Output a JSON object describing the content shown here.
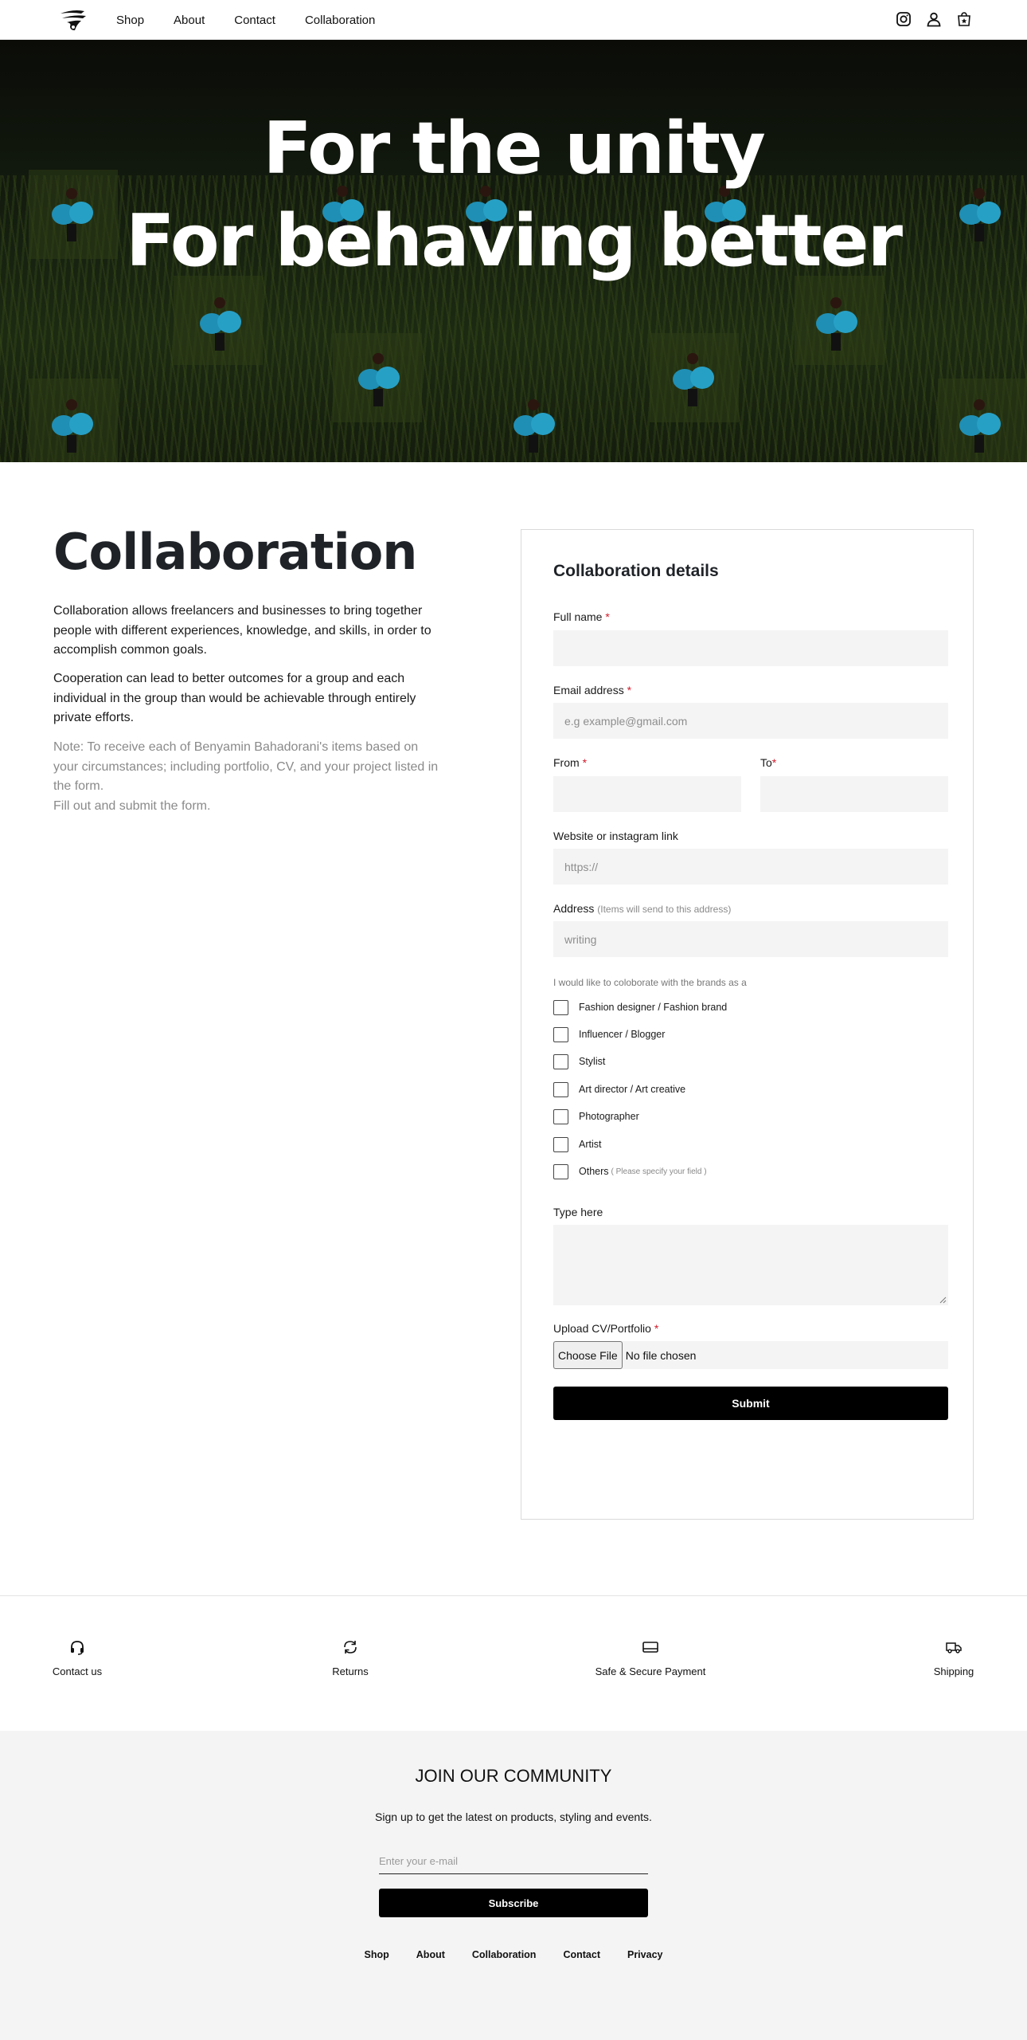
{
  "header": {
    "nav": [
      "Shop",
      "About",
      "Contact",
      "Collaboration"
    ],
    "icons": [
      "instagram-icon",
      "account-icon",
      "cart-icon"
    ]
  },
  "hero": {
    "line1": "For the unity",
    "line2": "For behaving better"
  },
  "intro": {
    "title": "Collaboration",
    "p1": "Collaboration allows freelancers and businesses to bring together people with different experiences, knowledge, and skills, in order to accomplish common goals.",
    "p2": "Cooperation can lead to better outcomes for a group and each individual in the group than would be achievable through entirely private efforts.",
    "note1": "Note: To receive each of Benyamin Bahadorani's items based on your circumstances; including portfolio, CV, and your project listed in the form.",
    "note2": "Fill out and submit the form."
  },
  "form": {
    "title": "Collaboration details",
    "full_name_label": "Full name",
    "email_label": "Email address",
    "email_placeholder": "e.g example@gmail.com",
    "from_label": "From",
    "to_label": "To",
    "website_label": "Website or instagram link",
    "website_placeholder": "https://",
    "address_label": "Address",
    "address_hint": "(Items will send to this address)",
    "address_placeholder": "writing",
    "required_mark": "*",
    "group_caption": "I would like to coloborate with the brands as a",
    "options": [
      "Fashion designer / Fashion brand",
      "Influencer / Blogger",
      "Stylist",
      "Art director / Art creative",
      "Photographer",
      "Artist",
      "Others"
    ],
    "others_hint": "( Please specify your field )",
    "type_here_label": "Type here",
    "upload_label": "Upload CV/Portfolio",
    "choose_file": "Choose File",
    "no_file": "No file chosen",
    "submit": "Submit"
  },
  "services": [
    {
      "label": "Contact us",
      "icon": "headset-icon"
    },
    {
      "label": "Returns",
      "icon": "returns-icon"
    },
    {
      "label": "Safe & Secure Payment",
      "icon": "card-icon"
    },
    {
      "label": "Shipping",
      "icon": "truck-icon"
    }
  ],
  "newsletter": {
    "title": "JOIN OUR COMMUNITY",
    "subtitle": "Sign up to get the latest on products, styling and events.",
    "email_placeholder": "Enter your e-mail",
    "button": "Subscribe"
  },
  "footer": {
    "links": [
      "Shop",
      "About",
      "Collaboration",
      "Contact",
      "Privacy"
    ]
  }
}
